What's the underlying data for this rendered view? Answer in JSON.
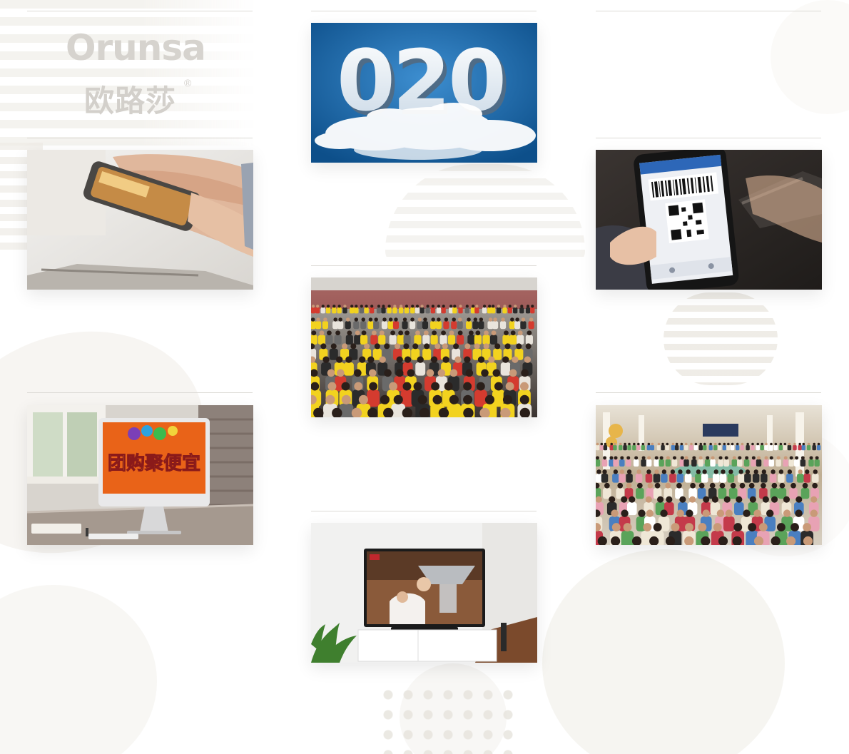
{
  "brand": {
    "name_en": "Orunsa",
    "name_cn": "欧路莎",
    "registered_mark": "®",
    "logo_color": "#d3d0cb"
  },
  "tiles": [
    {
      "id": "o2o",
      "icon": "o2o-clouds-image",
      "banner_text": "020"
    },
    {
      "id": "phone-payment",
      "icon": "mobile-payment-image"
    },
    {
      "id": "qr-scan",
      "icon": "qr-code-scan-image"
    },
    {
      "id": "expo-crowd",
      "icon": "expo-crowd-image"
    },
    {
      "id": "group-buy",
      "icon": "group-buy-computer-image",
      "screen_text": "团购聚便宜"
    },
    {
      "id": "showroom",
      "icon": "showroom-crowd-image"
    },
    {
      "id": "tv-ad",
      "icon": "tv-advertisement-image"
    }
  ],
  "colors": {
    "divider": "#dcdad5",
    "accent_blue": "#1f6fae",
    "accent_yellow": "#f2d21f"
  }
}
